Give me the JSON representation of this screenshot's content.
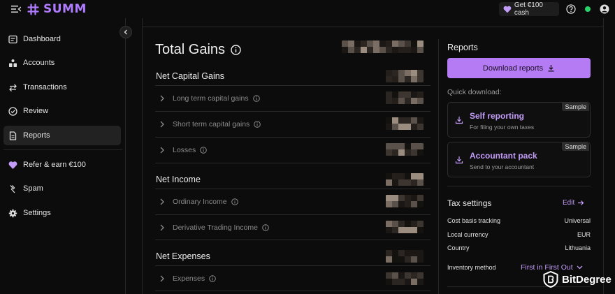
{
  "topbar": {
    "logo_text": "SUMM",
    "get_cash_label": "Get €100 cash",
    "icons": [
      "menu-toggle-icon",
      "summ-logo-icon",
      "heart-icon",
      "help-icon",
      "user-icon"
    ],
    "status_color": "#28d36a"
  },
  "sidebar": {
    "items": [
      {
        "label": "Dashboard",
        "icon": "dashboard-icon"
      },
      {
        "label": "Accounts",
        "icon": "accounts-icon"
      },
      {
        "label": "Transactions",
        "icon": "transactions-icon"
      },
      {
        "label": "Review",
        "icon": "check-circle-icon"
      },
      {
        "label": "Reports",
        "icon": "document-icon",
        "active": true
      },
      {
        "label": "Refer & earn €100",
        "icon": "heart-icon"
      },
      {
        "label": "Spam",
        "icon": "spam-icon"
      },
      {
        "label": "Settings",
        "icon": "gear-icon"
      }
    ]
  },
  "main": {
    "title": "Total Gains",
    "sections": [
      {
        "label": "Net Capital Gains",
        "rows": [
          "Long term capital gains",
          "Short term capital gains",
          "Losses"
        ]
      },
      {
        "label": "Net Income",
        "rows": [
          "Ordinary Income",
          "Derivative Trading Income"
        ]
      },
      {
        "label": "Net Expenses",
        "rows": [
          "Expenses"
        ]
      }
    ]
  },
  "reports": {
    "title": "Reports",
    "download_label": "Download reports",
    "quick_label": "Quick download:",
    "cards": [
      {
        "title": "Self reporting",
        "subtitle": "For filing your own taxes",
        "badge": "Sample"
      },
      {
        "title": "Accountant pack",
        "subtitle": "Send to your accountant",
        "badge": "Sample"
      }
    ]
  },
  "tax_settings": {
    "title": "Tax settings",
    "edit_label": "Edit",
    "rows": [
      {
        "key": "Cost basis tracking",
        "value": "Universal"
      },
      {
        "key": "Local currency",
        "value": "EUR"
      },
      {
        "key": "Country",
        "value": "Lithuania"
      }
    ],
    "inventory_key": "Inventory method",
    "inventory_value": "First in First Out"
  },
  "watermark": "BitDegree",
  "colors": {
    "accent": "#b57bf5",
    "accent_text": "#c39cf7",
    "background": "#0c0c0c",
    "muted_text": "#8a8a8a"
  }
}
